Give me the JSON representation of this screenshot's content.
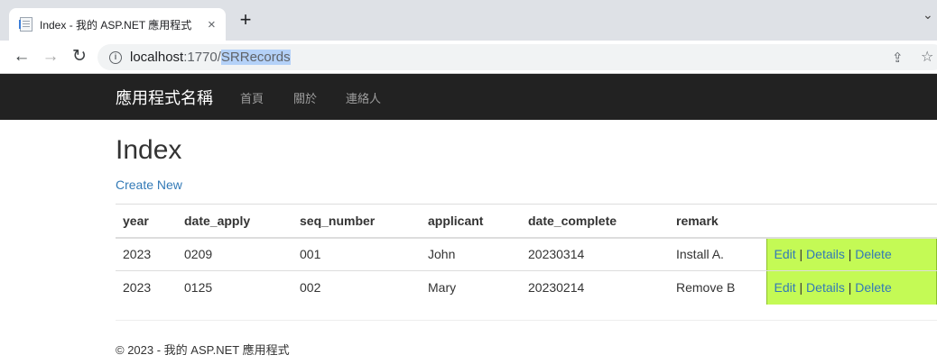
{
  "browser": {
    "tab_title": "Index - 我的 ASP.NET 應用程式",
    "tab_close": "×",
    "new_tab": "+",
    "tab_menu": "⌄",
    "back": "←",
    "forward": "→",
    "reload": "↻",
    "info": "i",
    "url_host": "localhost",
    "url_port": ":1770/",
    "url_path": "SRRecords",
    "share": "⇪",
    "star": "☆"
  },
  "navbar": {
    "brand": "應用程式名稱",
    "links": [
      "首頁",
      "關於",
      "連絡人"
    ]
  },
  "page": {
    "title": "Index",
    "create_new": "Create New"
  },
  "table": {
    "columns": [
      "year",
      "date_apply",
      "seq_number",
      "applicant",
      "date_complete",
      "remark"
    ],
    "rows": [
      {
        "year": "2023",
        "date_apply": "0209",
        "seq_number": "001",
        "applicant": "John",
        "date_complete": "20230314",
        "remark": "Install A."
      },
      {
        "year": "2023",
        "date_apply": "0125",
        "seq_number": "002",
        "applicant": "Mary",
        "date_complete": "20230214",
        "remark": "Remove B"
      }
    ],
    "actions": {
      "edit": "Edit",
      "details": "Details",
      "delete": "Delete",
      "separator": "|"
    }
  },
  "footer": {
    "text": "© 2023 - 我的 ASP.NET 應用程式"
  },
  "colors": {
    "highlight": "#c4fa55",
    "link": "#337ab7",
    "navbar": "#222222"
  }
}
